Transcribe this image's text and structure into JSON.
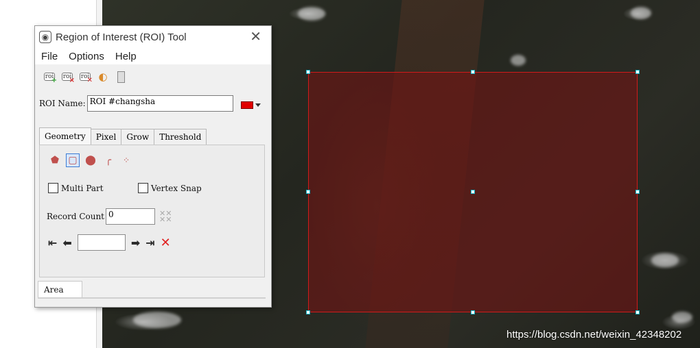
{
  "window": {
    "title": "Region of Interest (ROI) Tool",
    "close_glyph": "✕"
  },
  "menu": {
    "items": [
      "File",
      "Options",
      "Help"
    ]
  },
  "toolbar": {
    "icons": [
      "new-roi-icon",
      "delete-roi-icon",
      "delete-all-roi-icon",
      "roi-properties-icon",
      "roi-stats-icon"
    ],
    "roi_glyph": "roi"
  },
  "roi_name": {
    "label": "ROI Name:",
    "value": "ROI #changsha",
    "color": "#e00000"
  },
  "tabs": [
    "Geometry",
    "Pixel",
    "Grow",
    "Threshold"
  ],
  "geometry": {
    "tools": [
      "polygon-icon",
      "rectangle-icon",
      "ellipse-icon",
      "polyline-icon",
      "point-icon"
    ],
    "selected_tool": "rectangle-icon",
    "multi_part": "Multi Part",
    "vertex_snap": "Vertex Snap",
    "record_count_label": "Record Count",
    "record_count_value": "0"
  },
  "bottom_tab": "Area",
  "overlay": {
    "watermark": "https://blog.csdn.net/weixin_42348202",
    "roi_fill": "#781212",
    "roi_border": "#d21a1a",
    "handle_color": "#16b3c6"
  }
}
